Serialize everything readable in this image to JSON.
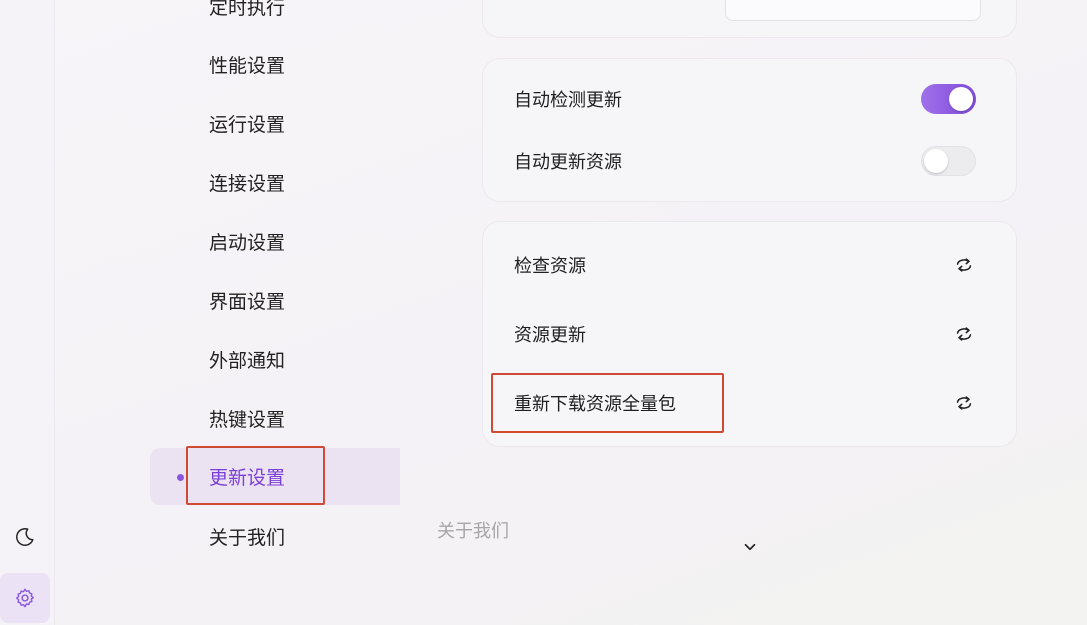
{
  "sidebar": {
    "items": [
      {
        "label": "定时执行"
      },
      {
        "label": "性能设置"
      },
      {
        "label": "运行设置"
      },
      {
        "label": "连接设置"
      },
      {
        "label": "启动设置"
      },
      {
        "label": "界面设置"
      },
      {
        "label": "外部通知"
      },
      {
        "label": "热键设置"
      },
      {
        "label": "更新设置",
        "active": true
      },
      {
        "label": "关于我们"
      }
    ]
  },
  "update_settings": {
    "auto_check": {
      "label": "自动检测更新",
      "enabled": true
    },
    "auto_update_resource": {
      "label": "自动更新资源",
      "enabled": false
    }
  },
  "resource_actions": {
    "check_resource": {
      "label": "检查资源",
      "icon": "refresh-icon"
    },
    "update_resource": {
      "label": "资源更新",
      "icon": "refresh-icon"
    },
    "redownload_full": {
      "label": "重新下载资源全量包",
      "icon": "refresh-icon"
    }
  },
  "section_footer": {
    "label": "关于我们",
    "icon": "chevron-down-icon"
  },
  "rail": {
    "theme_icon": "moon-icon",
    "settings_icon": "gear-icon"
  },
  "colors": {
    "accent": "#8a55e0",
    "highlight_box": "#cf4a32"
  }
}
